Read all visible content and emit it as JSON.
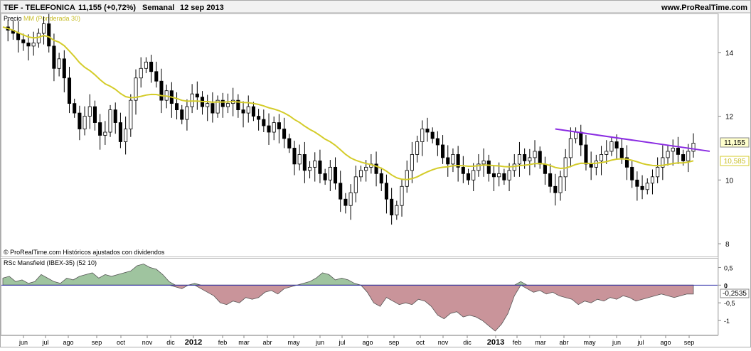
{
  "header": {
    "title": "TEF - TELEFONICA",
    "quote": "11,155 (+0,72%)",
    "period": "Semanal",
    "date": "12 sep 2013",
    "site": "www.ProRealTime.com"
  },
  "price_panel": {
    "legend_price": "Precio",
    "legend_ma": "MM (Ponderada 30)",
    "footer_note": "© ProRealTime.com  Históricos ajustados con dividendos",
    "last_price_label": "11,155",
    "ma_label": "10,585"
  },
  "rsc_panel": {
    "legend": "RSc Mansfield (IBEX-35) (52 10)",
    "value_label": "-0,2535"
  },
  "colors": {
    "background": "#ffffff",
    "frame": "#aaaaaa",
    "ma_line": "#d4cc2a",
    "trendline": "#8a2be2",
    "rsc_positive_fill": "#9fc49f",
    "rsc_negative_fill": "#c9949a",
    "zero_line": "#3333aa",
    "candle_up": "#ffffff",
    "candle_down": "#000000"
  },
  "chart_data": [
    {
      "type": "candlestick",
      "title": "TEF - TELEFONICA",
      "interval": "Semanal",
      "ylim": [
        7.6,
        15.2
      ],
      "yticks": [
        8,
        10,
        12,
        14
      ],
      "x_ticks": [
        "jun",
        "jul",
        "ago",
        "sep",
        "oct",
        "nov",
        "dic",
        "2012",
        "feb",
        "mar",
        "abr",
        "may",
        "jun",
        "jul",
        "ago",
        "sep",
        "oct",
        "nov",
        "dic",
        "2013",
        "feb",
        "mar",
        "abr",
        "may",
        "jun",
        "jul",
        "ago",
        "sep"
      ],
      "x_ticks_bold": [
        "2012",
        "2013"
      ],
      "week_index_range": [
        0,
        120
      ],
      "tick_week_index": [
        6,
        13,
        20,
        27,
        35,
        44,
        52,
        59,
        68,
        76,
        83,
        92,
        100,
        108,
        116,
        124,
        133,
        141,
        150,
        158,
        167,
        175,
        183,
        192,
        200,
        208,
        217,
        225
      ],
      "close_series_approx": [
        14.8,
        14.7,
        14.6,
        14.4,
        14.3,
        14.2,
        14.3,
        14.6,
        14.9,
        14.2,
        13.5,
        13.8,
        13.2,
        12.4,
        12.1,
        11.6,
        12.0,
        12.3,
        11.8,
        11.4,
        11.5,
        12.2,
        11.8,
        11.2,
        11.6,
        12.5,
        13.2,
        13.5,
        13.7,
        13.4,
        13.1,
        12.5,
        12.8,
        12.4,
        12.2,
        11.9,
        12.3,
        12.7,
        12.6,
        12.3,
        12.4,
        12.1,
        12.5,
        12.3,
        12.4,
        12.5,
        12.2,
        12.1,
        12.3,
        12.0,
        11.9,
        11.7,
        11.5,
        11.8,
        11.6,
        11.3,
        11.0,
        10.5,
        10.8,
        10.3,
        10.4,
        10.6,
        10.2,
        10.0,
        10.4,
        9.9,
        9.4,
        9.2,
        9.6,
        10.1,
        10.3,
        10.4,
        10.5,
        10.2,
        9.9,
        9.4,
        8.9,
        9.2,
        9.8,
        10.3,
        10.8,
        11.2,
        11.6,
        11.5,
        11.3,
        11.1,
        10.7,
        10.5,
        10.8,
        10.4,
        10.2,
        10.0,
        10.3,
        10.5,
        10.6,
        10.2,
        10.1,
        10.2,
        10.0,
        10.3,
        10.5,
        10.8,
        10.6,
        10.7,
        10.9,
        10.5,
        10.2,
        9.8,
        9.6,
        10.1,
        10.7,
        11.3,
        11.5,
        11.1,
        10.5,
        10.4,
        10.6,
        10.8,
        10.9,
        11.2,
        11.0,
        10.7,
        10.4,
        10.0,
        9.8,
        9.7,
        9.9,
        10.1,
        10.4,
        10.7,
        10.9,
        11.0,
        10.8,
        10.6,
        10.9,
        11.155
      ],
      "series": [
        {
          "name": "MM (Ponderada 30)",
          "last_value": 10.585
        }
      ],
      "annotations": [
        {
          "type": "trendline",
          "from": {
            "label": "abr 2013"
          },
          "to": {
            "label": "sep 2013"
          },
          "from_value": 11.6,
          "to_value": 10.9
        }
      ]
    },
    {
      "type": "area",
      "title": "RSc Mansfield (IBEX-35) (52 10)",
      "ylim": [
        -1.4,
        0.75
      ],
      "yticks": [
        -1,
        -0.5,
        0,
        0.5
      ],
      "ytick_labels": [
        "-1",
        "-0,5",
        "0",
        "0,5"
      ],
      "last_value": -0.2535,
      "values_approx": [
        0.2,
        0.25,
        0.1,
        0.15,
        0.05,
        0.1,
        0.3,
        0.2,
        0.1,
        0.05,
        0.2,
        0.15,
        0.25,
        0.3,
        0.35,
        0.2,
        0.3,
        0.25,
        0.3,
        0.35,
        0.4,
        0.55,
        0.6,
        0.5,
        0.45,
        0.3,
        0.1,
        -0.05,
        -0.1,
        0.0,
        0.05,
        -0.1,
        -0.2,
        -0.3,
        -0.5,
        -0.55,
        -0.45,
        -0.5,
        -0.35,
        -0.4,
        -0.35,
        -0.2,
        -0.15,
        -0.25,
        -0.1,
        -0.05,
        0.0,
        0.05,
        0.1,
        0.2,
        0.35,
        0.3,
        0.15,
        0.2,
        0.15,
        0.05,
        0.0,
        -0.2,
        -0.5,
        -0.6,
        -0.35,
        -0.45,
        -0.55,
        -0.5,
        -0.55,
        -0.4,
        -0.45,
        -0.6,
        -0.85,
        -0.95,
        -0.8,
        -0.75,
        -0.9,
        -0.85,
        -0.9,
        -1.0,
        -1.15,
        -1.3,
        -1.1,
        -0.8,
        -0.3,
        0.1,
        -0.1,
        -0.2,
        -0.15,
        -0.25,
        -0.2,
        -0.3,
        -0.35,
        -0.4,
        -0.55,
        -0.45,
        -0.5,
        -0.4,
        -0.45,
        -0.35,
        -0.4,
        -0.3,
        -0.35,
        -0.45,
        -0.4,
        -0.35,
        -0.3,
        -0.25,
        -0.3,
        -0.35,
        -0.3,
        -0.25,
        -0.2535
      ]
    }
  ]
}
